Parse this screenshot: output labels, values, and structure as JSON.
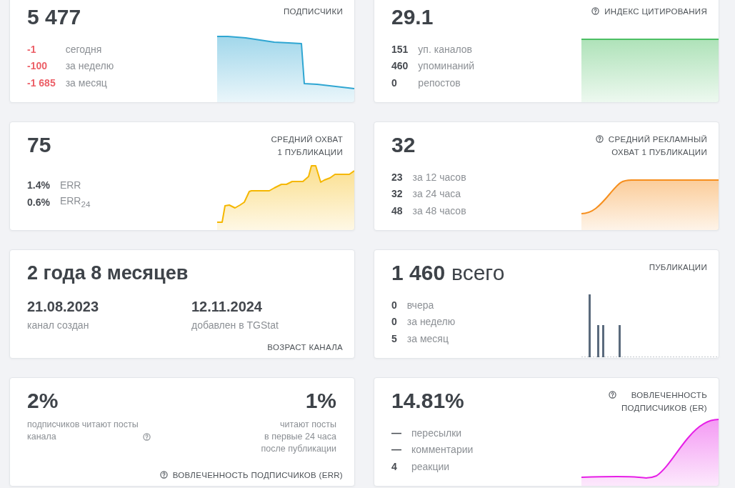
{
  "cards": [
    {
      "kind": "metric",
      "value": "5 477",
      "title": [
        "ПОДПИСЧИКИ"
      ],
      "stats": [
        {
          "value": "-1",
          "label": "сегодня",
          "negative": true
        },
        {
          "value": "-100",
          "label": "за неделю",
          "negative": true
        },
        {
          "value": "-1 685",
          "label": "за месяц",
          "negative": true
        }
      ],
      "chart": {
        "kind": "area"
      }
    },
    {
      "kind": "metric",
      "value": "29.1",
      "title": [
        "ИНДЕКС ЦИТИРОВАНИЯ"
      ],
      "help": true,
      "stats": [
        {
          "value": "151",
          "label": "уп. каналов"
        },
        {
          "value": "460",
          "label": "упоминаний"
        },
        {
          "value": "0",
          "label": "репостов"
        }
      ],
      "chart": {
        "kind": "area"
      }
    },
    {
      "kind": "metric",
      "value": "75",
      "title": [
        "СРЕДНИЙ ОХВАТ",
        "1 ПУБЛИКАЦИИ"
      ],
      "stats": [
        {
          "value": "1.4%",
          "label": "ERR"
        },
        {
          "value": "0.6%",
          "label": "ERR$_{24}$"
        }
      ],
      "chart": {
        "kind": "area"
      }
    },
    {
      "kind": "metric",
      "value": "32",
      "title": [
        "СРЕДНИЙ РЕКЛАМНЫЙ",
        "ОХВАТ 1 ПУБЛИКАЦИИ"
      ],
      "help": true,
      "stats": [
        {
          "value": "23",
          "label": "за 12 часов"
        },
        {
          "value": "32",
          "label": "за 24 часа"
        },
        {
          "value": "48",
          "label": "за 48 часов"
        }
      ],
      "chart": {
        "kind": "area"
      }
    },
    {
      "kind": "age",
      "value": "2 года 8 месяцев",
      "dates": [
        {
          "date": "21.08.2023",
          "caption": "канал создан"
        },
        {
          "date": "12.11.2024",
          "caption": "добавлен в TGStat"
        }
      ],
      "title": [
        "ВОЗРАСТ КАНАЛА"
      ]
    },
    {
      "kind": "metric",
      "value": "1 460",
      "unit": "всего",
      "title": [
        "ПУБЛИКАЦИИ"
      ],
      "stats": [
        {
          "value": "0",
          "label": "вчера"
        },
        {
          "value": "0",
          "label": "за неделю"
        },
        {
          "value": "5",
          "label": "за месяц"
        }
      ],
      "chart": {
        "kind": "bars"
      }
    },
    {
      "kind": "err",
      "columns": [
        {
          "value": "2%",
          "text": [
            "подписчиков читают посты",
            "канала"
          ],
          "help": true
        },
        {
          "value": "1%",
          "text": [
            "читают посты",
            "в первые 24 часа",
            "после публикации"
          ]
        }
      ],
      "title": [
        "ВОВЛЕЧЕННОСТЬ ПОДПИСЧИКОВ (ERR)"
      ],
      "help": true
    },
    {
      "kind": "metric",
      "value": "14.81%",
      "title": [
        "ВОВЛЕЧЕННОСТЬ",
        "ПОДПИСЧИКОВ (ER)"
      ],
      "help": true,
      "stats": [
        {
          "value": "—",
          "label": "пересылки"
        },
        {
          "value": "—",
          "label": "комментарии"
        },
        {
          "value": "4",
          "label": "реакции"
        }
      ],
      "chart": {
        "kind": "area"
      }
    }
  ]
}
